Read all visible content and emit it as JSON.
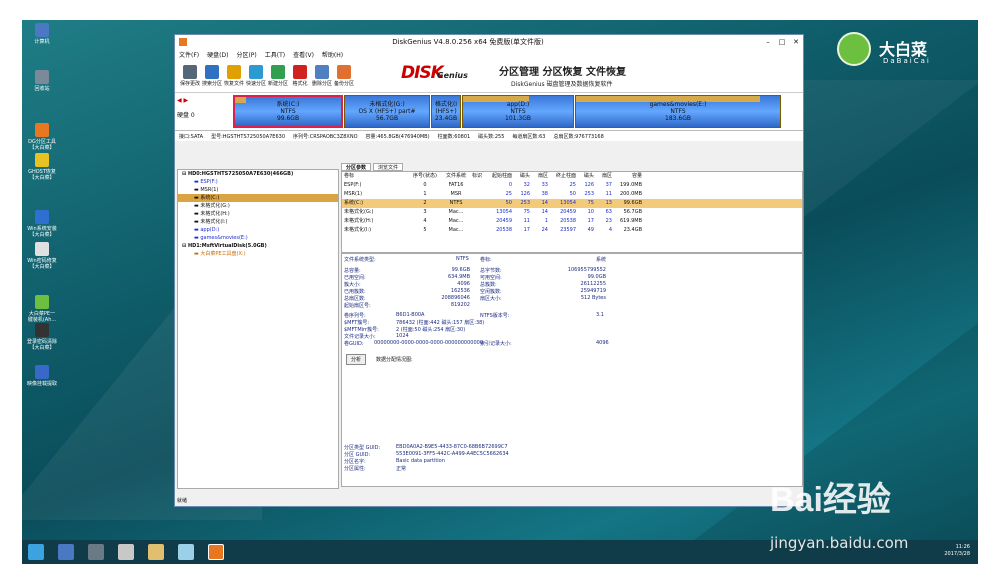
{
  "desktop": {
    "icons": [
      {
        "label": "计算机",
        "color": "#4a78c2"
      },
      {
        "label": "回收站",
        "color": "#7b8a99"
      },
      {
        "label": "DG分区工具\n【大白菜】",
        "color": "#e87722"
      },
      {
        "label": "GHOST恢复\n【大白菜】",
        "color": "#e8c222"
      },
      {
        "label": "Win系统安装\n【大白菜】",
        "color": "#2f6fd0"
      },
      {
        "label": "Win密码修复\n【大白菜】",
        "color": "#e0e0e0"
      },
      {
        "label": "大白菜PE一\n键装机(Ah...",
        "color": "#6cbf3f"
      },
      {
        "label": "登录密码清除\n【大白菜】",
        "color": "#333333"
      },
      {
        "label": "映像挂载提取",
        "color": "#3a68c8"
      }
    ],
    "logo": {
      "cn": "大白菜",
      "en": "DaBaiCai"
    }
  },
  "window": {
    "title": "DiskGenius V4.8.0.256 x64 免费版(单文件版)",
    "menu": [
      "文件(F)",
      "硬盘(D)",
      "分区(P)",
      "工具(T)",
      "查看(V)",
      "帮助(H)"
    ],
    "toolbar": [
      "保存更改",
      "搜索分区",
      "恢复文件",
      "快速分区",
      "新建分区",
      "格式化",
      "删除分区",
      "备份分区"
    ],
    "banner": {
      "dk": "DISK",
      "genius": "Genius",
      "headline": "分区管理 分区恢复 文件恢复",
      "sub": "DiskGenius 磁盘管理及数据恢复软件"
    },
    "disk": {
      "label": "硬盘 0",
      "partitions": [
        {
          "name": "系统(C:)",
          "fs": "NTFS",
          "size": "99.6GB"
        },
        {
          "name": "未格式化(G:)",
          "fs": "OS X (HFS+) part#",
          "size": "56.7GB"
        },
        {
          "name": "格式化(I",
          "fs": "(HFS+)",
          "size": "23.4GB"
        },
        {
          "name": "app(D:)",
          "fs": "NTFS",
          "size": "101.3GB"
        },
        {
          "name": "games&movies(E:)",
          "fs": "NTFS",
          "size": "183.6GB"
        }
      ]
    },
    "infoline": [
      "接口:SATA",
      "型号:HGSTHTS725050A7E630",
      "序列号:CRSPAOBC3Z8XNO",
      "容量:465.8GB(476940MB)",
      "柱面数:60801",
      "磁头数:255",
      "每道扇区数:63",
      "总扇区数:976773168"
    ],
    "tree": [
      {
        "t": "HD0:HGSTHTS725050A7E630(466GB)",
        "lv": 0,
        "bold": true
      },
      {
        "t": "ESP(F:)",
        "lv": 1,
        "color": "#1c2bd0"
      },
      {
        "t": "MSR(1)",
        "lv": 1
      },
      {
        "t": "系统(C:)",
        "lv": 1,
        "sel": true
      },
      {
        "t": "未格式化(G:)",
        "lv": 1
      },
      {
        "t": "未格式化(H:)",
        "lv": 1
      },
      {
        "t": "未格式化(I:)",
        "lv": 1
      },
      {
        "t": "app(D:)",
        "lv": 1,
        "color": "#1c2bd0"
      },
      {
        "t": "games&movies(E:)",
        "lv": 1,
        "color": "#1c2bd0"
      },
      {
        "t": "HD1:MsftVirtualDisk(5.0GB)",
        "lv": 0,
        "bold": true
      },
      {
        "t": "大白菜PE工具盘(X:)",
        "lv": 1,
        "color": "#c96a00"
      }
    ],
    "tabs": [
      "分区参数",
      "浏览文件"
    ],
    "table": {
      "headers": [
        "卷标",
        "序号(状态)",
        "文件系统",
        "标识",
        "起始柱面",
        "磁头",
        "扇区",
        "终止柱面",
        "磁头",
        "扇区",
        "容量"
      ],
      "rows": [
        [
          "ESP(F:)",
          "0",
          "FAT16",
          "",
          "0",
          "32",
          "33",
          "25",
          "126",
          "37",
          "199.0MB"
        ],
        [
          "MSR(1)",
          "1",
          "MSR",
          "",
          "25",
          "126",
          "38",
          "50",
          "253",
          "11",
          "200.0MB"
        ],
        [
          "系统(C:)",
          "2",
          "NTFS",
          "",
          "50",
          "253",
          "14",
          "13054",
          "75",
          "13",
          "99.6GB"
        ],
        [
          "未格式化(G:)",
          "3",
          "Mac...",
          "",
          "13054",
          "75",
          "14",
          "20459",
          "10",
          "63",
          "56.7GB"
        ],
        [
          "未格式化(H:)",
          "4",
          "Mac...",
          "",
          "20459",
          "11",
          "1",
          "20538",
          "17",
          "23",
          "619.9MB"
        ],
        [
          "未格式化(I:)",
          "5",
          "Mac...",
          "",
          "20538",
          "17",
          "24",
          "23597",
          "49",
          "4",
          "23.4GB"
        ]
      ]
    },
    "details": {
      "fs_type_label": "文件系统类型:",
      "fs_type": "NTFS",
      "vol_label": "卷标:",
      "vol": "系统",
      "left": [
        [
          "总容量:",
          "99.6GB"
        ],
        [
          "已用空间:",
          "634.9MB"
        ],
        [
          "簇大小:",
          "4096"
        ],
        [
          "已用簇数:",
          "162536"
        ],
        [
          "总扇区数:",
          "208896046"
        ],
        [
          "起始扇区号:",
          "819202"
        ]
      ],
      "right": [
        [
          "总字节数:",
          "106955799552"
        ],
        [
          "可用空间:",
          "99.0GB"
        ],
        [
          "总簇数:",
          "26112255"
        ],
        [
          "空闲簇数:",
          "25949719"
        ],
        [
          "扇区大小:",
          "512 Bytes"
        ]
      ],
      "left2": [
        [
          "卷序列号:",
          "B6D1-B00A"
        ],
        [
          "$MFT簇号:",
          "786432 (柱面:442 磁头:157 扇区:38)"
        ],
        [
          "$MFTMirr簇号:",
          "2 (柱面:50 磁头:254 扇区:30)"
        ],
        [
          "文件记录大小:",
          "1024"
        ],
        [
          "卷GUID:",
          "00000000-0000-0000-0000-000000000000"
        ]
      ],
      "right2": [
        [
          "NTFS版本号:",
          "3.1"
        ],
        [
          "索引记录大小:",
          "4096"
        ]
      ],
      "analyze": "分析",
      "analyze_text": "数据分配情况图:",
      "guid": [
        [
          "分区类型 GUID:",
          "EBD0A0A2-B9E5-4433-87C0-68B6B72699C7"
        ],
        [
          "分区 GUID:",
          "553E0091-3FF5-442C-A499-A4EC5C5662634"
        ],
        [
          "分区名字:",
          "Basic data partition"
        ],
        [
          "分区属性:",
          "正常"
        ]
      ]
    },
    "status": "就绪"
  },
  "taskbar": {
    "time": "11:26",
    "date": "2017/3/28"
  },
  "watermark": {
    "brand": "Bai经验",
    "url": "jingyan.baidu.com"
  }
}
